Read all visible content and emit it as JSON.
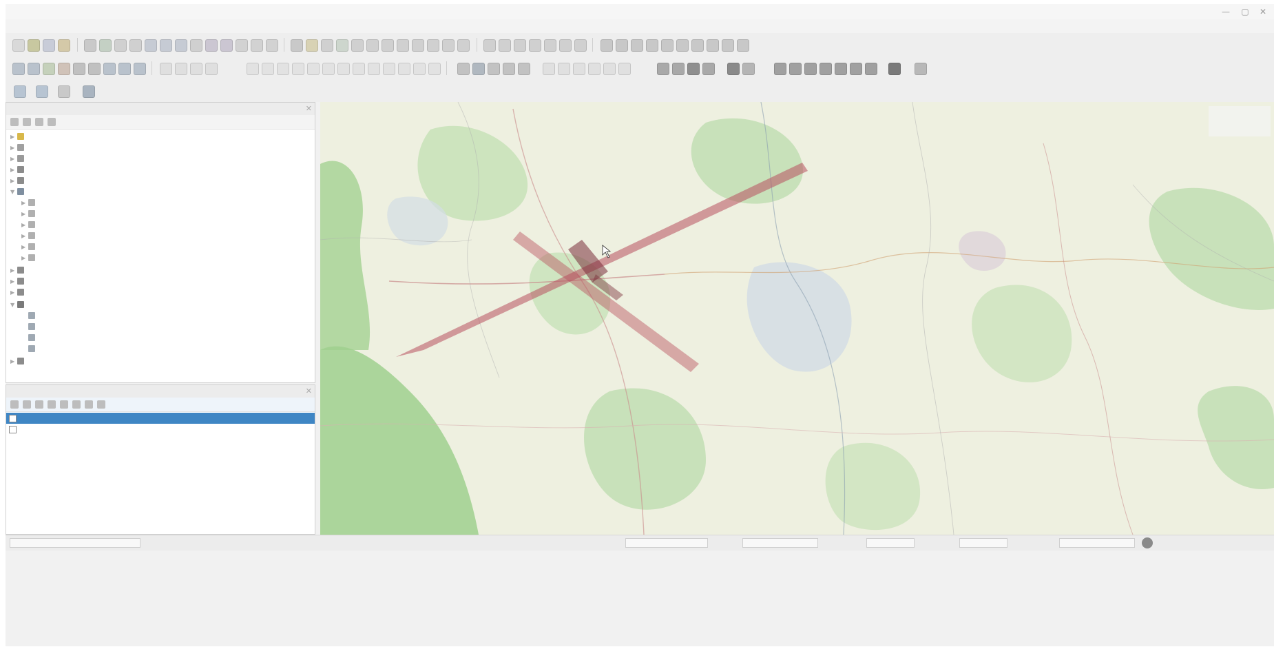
{
  "window": {
    "title": "",
    "controls": [
      "—",
      "▢",
      "✕"
    ]
  },
  "menus": [
    "",
    "",
    "",
    "",
    "",
    "",
    "",
    "",
    "",
    "",
    "",
    "",
    ""
  ],
  "browser_panel": {
    "title": "",
    "items": [
      {
        "label": "",
        "icon": "star-icon"
      },
      {
        "label": "",
        "icon": "home-icon"
      },
      {
        "label": "",
        "icon": "drive-icon"
      },
      {
        "label": "",
        "icon": "geopackage-icon"
      },
      {
        "label": "",
        "icon": "spatialite-icon"
      },
      {
        "label": "",
        "icon": "postgis-icon"
      },
      {
        "label": "",
        "icon": "database-icon"
      },
      {
        "label": "",
        "icon": "database-icon"
      },
      {
        "label": "",
        "icon": "database-icon"
      },
      {
        "label": "",
        "icon": "database-icon"
      },
      {
        "label": "",
        "icon": "database-icon"
      },
      {
        "label": "",
        "icon": "database-icon"
      },
      {
        "label": "",
        "icon": "mssql-icon"
      },
      {
        "label": "",
        "icon": "oracle-icon"
      },
      {
        "label": "",
        "icon": "wms-icon"
      },
      {
        "label": "",
        "icon": "xyz-tiles-icon"
      },
      {
        "label": "",
        "icon": "tile-icon"
      },
      {
        "label": "",
        "icon": "tile-icon"
      },
      {
        "label": "",
        "icon": "tile-icon"
      },
      {
        "label": "",
        "icon": "tile-icon"
      },
      {
        "label": "",
        "icon": "wfs-icon"
      }
    ]
  },
  "layers_panel": {
    "title": "",
    "layers": [
      {
        "label": "",
        "selected": true
      },
      {
        "label": "",
        "selected": false
      }
    ]
  },
  "statusbar": {
    "coordinate_label": "",
    "coordinate": "",
    "scale_label": "",
    "scale": "",
    "magnifier_label": "",
    "magnifier": "",
    "rotation_label": "",
    "rotation": "",
    "render_label": "",
    "crs": ""
  },
  "colors": {
    "selection": "#3f86c4",
    "wedge_fill": "#b8505e",
    "map_green": "#9fd08e",
    "map_base": "#eef0e0",
    "map_urban": "#d3dde4"
  }
}
